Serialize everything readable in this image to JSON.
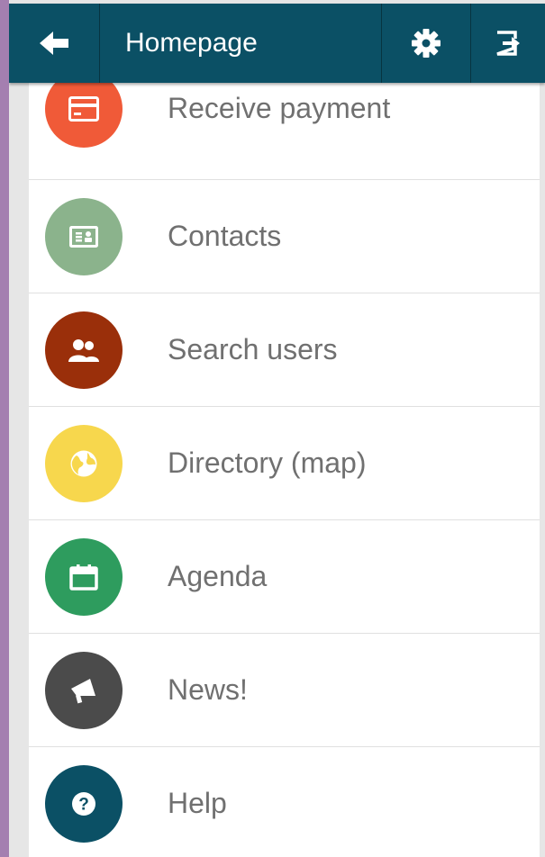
{
  "header": {
    "title": "Homepage",
    "back_icon": "arrow-left-icon",
    "settings_icon": "gear-icon",
    "logout_icon": "logout-icon",
    "color": "#0b5065"
  },
  "menu": {
    "items": [
      {
        "label": "Receive payment",
        "icon": "credit-card-icon",
        "color": "#f05a38"
      },
      {
        "label": "Contacts",
        "icon": "contact-card-icon",
        "color": "#8bb38c"
      },
      {
        "label": "Search users",
        "icon": "users-icon",
        "color": "#9a2f0a"
      },
      {
        "label": "Directory (map)",
        "icon": "globe-icon",
        "color": "#f7d74d"
      },
      {
        "label": "Agenda",
        "icon": "calendar-icon",
        "color": "#2e9c5e"
      },
      {
        "label": "News!",
        "icon": "megaphone-icon",
        "color": "#4b4b4b"
      },
      {
        "label": "Help",
        "icon": "help-icon",
        "color": "#0b5065"
      }
    ]
  }
}
